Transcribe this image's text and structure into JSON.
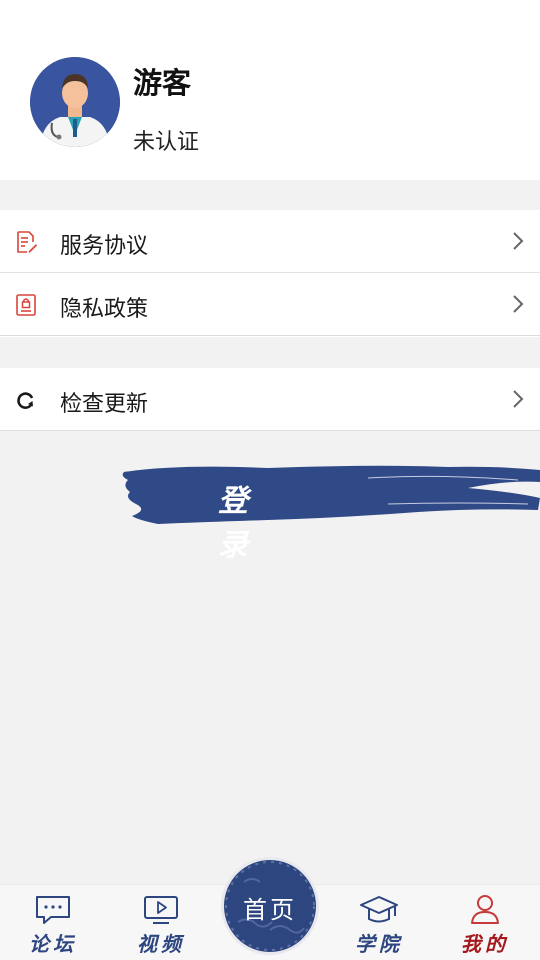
{
  "profile": {
    "name": "游客",
    "status": "未认证"
  },
  "menu": [
    {
      "label": "服务协议",
      "icon": "document-edit-icon"
    },
    {
      "label": "隐私政策",
      "icon": "privacy-lock-icon"
    }
  ],
  "menu2": [
    {
      "label": "检查更新",
      "icon": "refresh-icon"
    }
  ],
  "login": {
    "label": "登 录"
  },
  "tabbar": {
    "items": [
      {
        "label": "论坛",
        "icon": "chat-bubble-icon",
        "active": false
      },
      {
        "label": "视频",
        "icon": "video-play-icon",
        "active": false
      },
      {
        "label": "首页",
        "icon": "home-icon",
        "active": false
      },
      {
        "label": "学院",
        "icon": "graduation-cap-icon",
        "active": false
      },
      {
        "label": "我的",
        "icon": "person-icon",
        "active": true
      }
    ]
  },
  "colors": {
    "accent_blue": "#2d467f",
    "active_red": "#a5191e",
    "icon_red": "#d9453b"
  }
}
